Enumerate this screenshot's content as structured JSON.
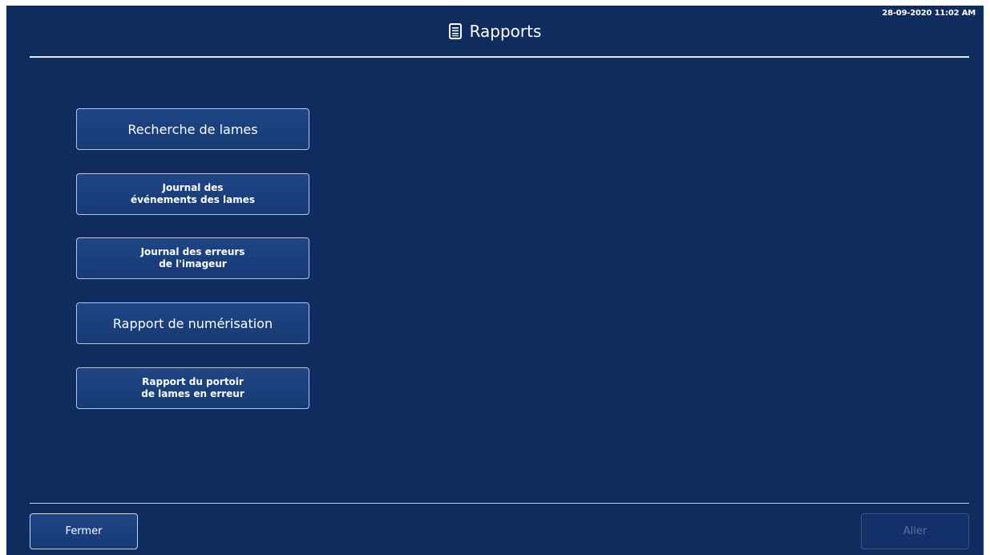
{
  "header": {
    "title": "Rapports",
    "timestamp": "28-09-2020 11:02 AM",
    "title_icon": "document-icon"
  },
  "menu": {
    "items": [
      {
        "label": "Recherche de lames",
        "size": "large"
      },
      {
        "label": "Journal des\névénements des lames",
        "size": "small"
      },
      {
        "label": "Journal des erreurs\nde l'imageur",
        "size": "small"
      },
      {
        "label": "Rapport de numérisation",
        "size": "large"
      },
      {
        "label": "Rapport du portoir\nde lames en erreur",
        "size": "small"
      }
    ]
  },
  "footer": {
    "close_label": "Fermer",
    "go_label": "Aller",
    "go_enabled": false
  },
  "colors": {
    "background": "#0f2c5f",
    "button": "#1f4585",
    "border": "#b9c6e0",
    "disabled_text": "#5a6f99"
  }
}
